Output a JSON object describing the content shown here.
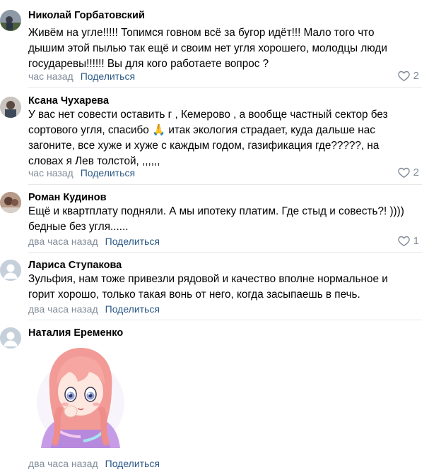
{
  "comments": [
    {
      "author": "Николай Горбатовский",
      "text": "Живём на угле!!!!! Топимся говном всё за бугор идёт!!! Мало того что\nдышим этой пылью так ещё и своим нет угля хорошего, молодцы люди\nгосударевы!!!!!! Вы для кого работаете вопрос ?",
      "time": "час назад",
      "share": "Поделиться",
      "likes": "2",
      "avatar": "photo"
    },
    {
      "author": "Ксана Чухарева",
      "text": "У вас нет совести оставить г , Кемерово , а вообще частный сектор без\nсортового угля, спасибо 🙏 итак экология страдает, куда дальше нас\nзагоните, все хуже и хуже с каждым годом, газификация где?????, на\nсловах я Лев толстой, ,,,,,,",
      "time": "час назад",
      "share": "Поделиться",
      "likes": "2",
      "avatar": "photo"
    },
    {
      "author": "Роман Кудинов",
      "text": "Ещё и квартплату подняли. А мы ипотеку платим. Где стыд и совесть?! ))))\nбедные без угля......",
      "time": "два часа назад",
      "share": "Поделиться",
      "likes": "1",
      "avatar": "photo"
    },
    {
      "author": "Лариса Ступакова",
      "text": "Зульфия, нам тоже привезли рядовой и качество вполне нормальное и\nгорит хорошо, только такая вонь от него, когда засыпаешь в печь.",
      "time": "два часа назад",
      "share": "Поделиться",
      "likes": "",
      "avatar": "default"
    },
    {
      "author": "Наталия Еременко",
      "text": "",
      "sticker": "anime-girl-sticker",
      "time": "два часа назад",
      "share": "Поделиться",
      "likes": "",
      "avatar": "default"
    }
  ],
  "colors": {
    "link": "#2a5885",
    "meta": "#818c99",
    "divider": "#e7e8ec",
    "default_avatar": "#c5d0db"
  },
  "icons": {
    "like": "heart-outline-icon",
    "default_avatar": "user-silhouette-icon"
  }
}
